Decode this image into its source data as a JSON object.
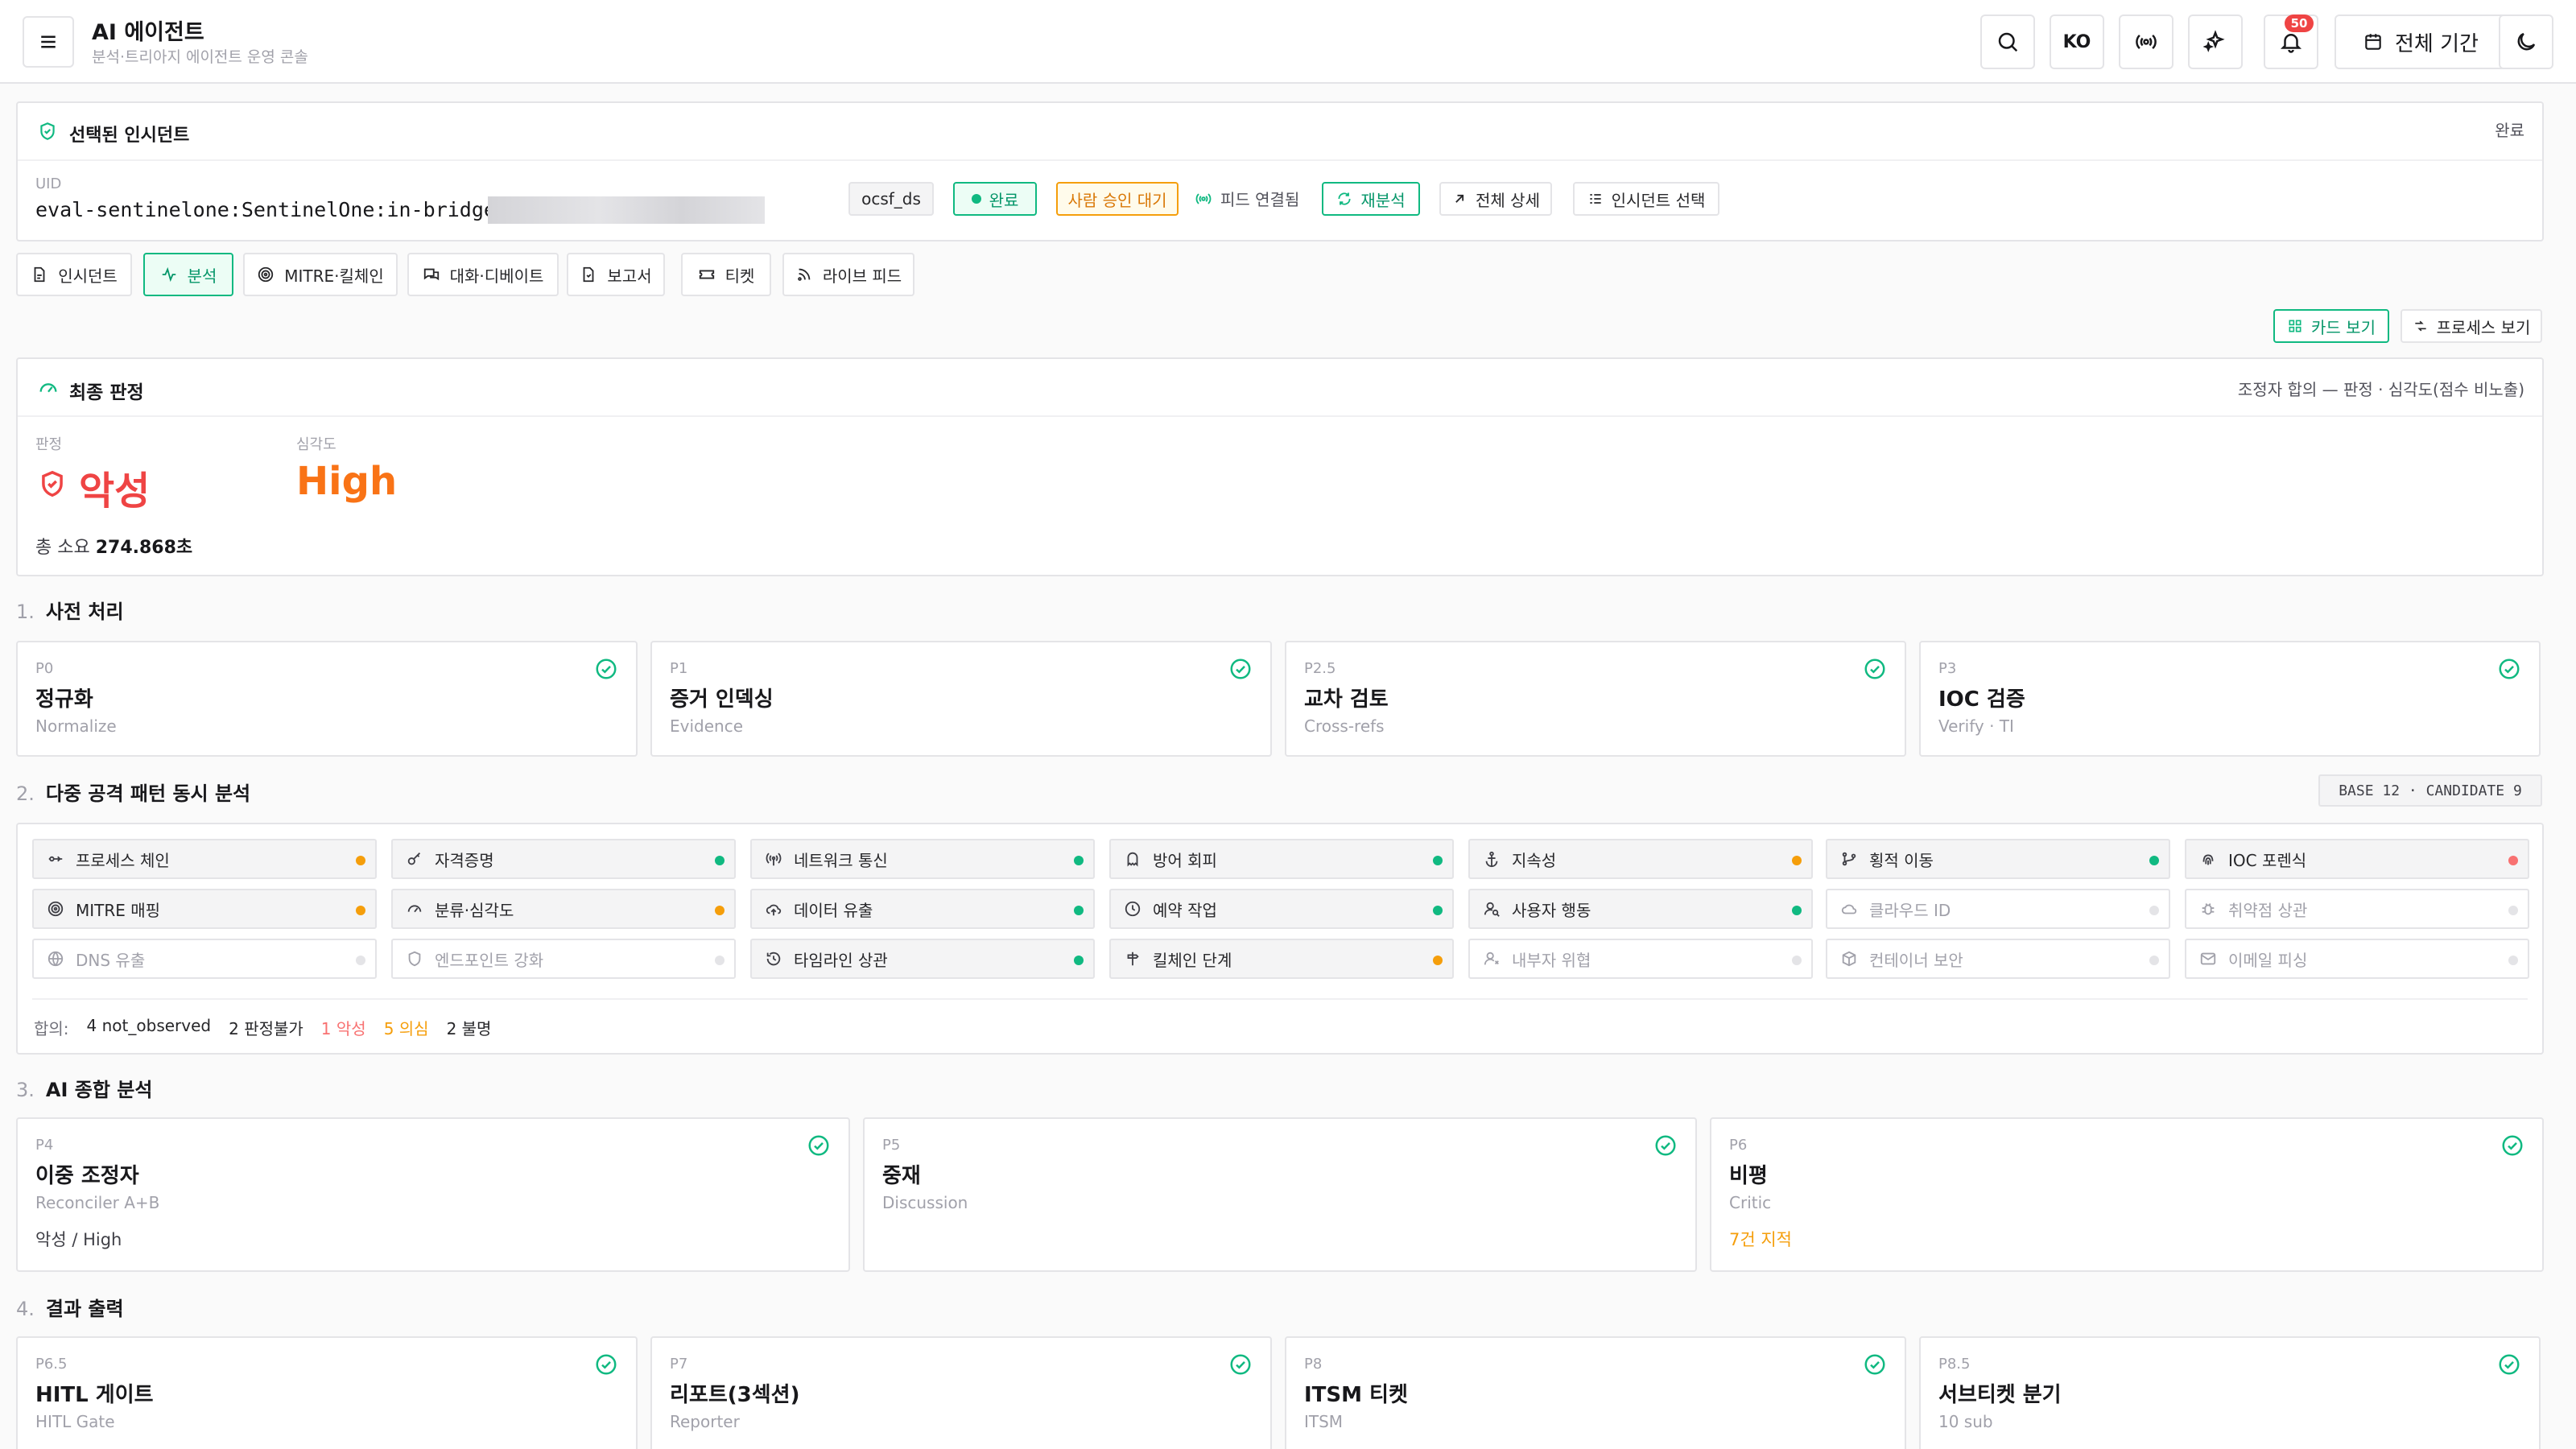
{
  "header": {
    "title": "AI 에이전트",
    "subtitle": "분석·트리아지 에이전트 운영 콘솔",
    "lang": "KO",
    "notif_count": "50",
    "period": "전체 기간"
  },
  "incident": {
    "title": "선택된 인시던트",
    "state_right": "완료",
    "uid_label": "UID",
    "uid_value": "eval-sentinelone:SentinelOne:in-bridge:",
    "tag_source": "ocsf_ds",
    "tag_status": "완료",
    "tag_approval": "사람 승인 대기",
    "feed_label": "피드 연결됨",
    "reanalyze": "재분석",
    "details": "전체 상세",
    "select": "인시던트 선택"
  },
  "tabs": [
    "인시던트",
    "분석",
    "MITRE·킬체인",
    "대화·디베이트",
    "보고서",
    "티켓",
    "라이브 피드"
  ],
  "view": {
    "card": "카드 보기",
    "process": "프로세스 보기"
  },
  "verdict": {
    "title": "최종 판정",
    "note": "조정자 합의 — 판정 · 심각도(점수 비노출)",
    "verdict_label": "판정",
    "verdict_value": "악성",
    "severity_label": "심각도",
    "severity_value": "High",
    "elapsed_label": "총 소요",
    "elapsed_value": "274.868초"
  },
  "sections": {
    "s1": {
      "num": "1.",
      "title": "사전 처리"
    },
    "s2": {
      "num": "2.",
      "title": "다중 공격 패턴 동시 분석",
      "badge": "BASE 12 · CANDIDATE 9"
    },
    "s3": {
      "num": "3.",
      "title": "AI 종합 분석"
    },
    "s4": {
      "num": "4.",
      "title": "결과 출력"
    }
  },
  "preprocess": [
    {
      "code": "P0",
      "name": "정규화",
      "sub": "Normalize"
    },
    {
      "code": "P1",
      "name": "증거 인덱싱",
      "sub": "Evidence"
    },
    {
      "code": "P2.5",
      "name": "교차 검토",
      "sub": "Cross-refs"
    },
    {
      "code": "P3",
      "name": "IOC 검증",
      "sub": "Verify · TI"
    }
  ],
  "patterns": [
    {
      "label": "프로세스 체인",
      "icon": "process-chain-icon",
      "status": "suspicious"
    },
    {
      "label": "자격증명",
      "icon": "key-icon",
      "status": "ok"
    },
    {
      "label": "네트워크 통신",
      "icon": "antenna-icon",
      "status": "ok"
    },
    {
      "label": "방어 회피",
      "icon": "ghost-icon",
      "status": "ok"
    },
    {
      "label": "지속성",
      "icon": "anchor-icon",
      "status": "suspicious"
    },
    {
      "label": "횡적 이동",
      "icon": "git-branch-icon",
      "status": "ok"
    },
    {
      "label": "IOC 포렌식",
      "icon": "fingerprint-icon",
      "status": "malicious"
    },
    {
      "label": "MITRE 매핑",
      "icon": "target-icon",
      "status": "suspicious"
    },
    {
      "label": "분류·심각도",
      "icon": "gauge-icon",
      "status": "suspicious"
    },
    {
      "label": "데이터 유출",
      "icon": "cloud-upload-icon",
      "status": "ok"
    },
    {
      "label": "예약 작업",
      "icon": "clock-icon",
      "status": "ok"
    },
    {
      "label": "사용자 행동",
      "icon": "user-search-icon",
      "status": "ok"
    },
    {
      "label": "클라우드 ID",
      "icon": "cloud-icon",
      "status": "inactive"
    },
    {
      "label": "취약점 상관",
      "icon": "bug-icon",
      "status": "inactive"
    },
    {
      "label": "DNS 유출",
      "icon": "globe-icon",
      "status": "inactive"
    },
    {
      "label": "엔드포인트 강화",
      "icon": "shield-icon",
      "status": "inactive"
    },
    {
      "label": "타임라인 상관",
      "icon": "history-icon",
      "status": "ok"
    },
    {
      "label": "킬체인 단계",
      "icon": "signpost-icon",
      "status": "suspicious"
    },
    {
      "label": "내부자 위협",
      "icon": "user-x-icon",
      "status": "inactive"
    },
    {
      "label": "컨테이너 보안",
      "icon": "container-icon",
      "status": "inactive"
    },
    {
      "label": "이메일 피싱",
      "icon": "mail-icon",
      "status": "inactive"
    }
  ],
  "consensus": {
    "label": "합의:",
    "not_observed": "4 not_observed",
    "undecidable": "2 판정불가",
    "malicious": "1 악성",
    "suspicious": "5 의심",
    "unknown": "2 불명"
  },
  "ai_analysis": [
    {
      "code": "P4",
      "name": "이중 조정자",
      "sub": "Reconciler A+B",
      "detail": "악성 / High"
    },
    {
      "code": "P5",
      "name": "중재",
      "sub": "Discussion",
      "detail": ""
    },
    {
      "code": "P6",
      "name": "비평",
      "sub": "Critic",
      "detail": "7건 지적"
    }
  ],
  "output": [
    {
      "code": "P6.5",
      "name": "HITL 게이트",
      "sub": "HITL Gate"
    },
    {
      "code": "P7",
      "name": "리포트(3섹션)",
      "sub": "Reporter"
    },
    {
      "code": "P8",
      "name": "ITSM 티켓",
      "sub": "ITSM"
    },
    {
      "code": "P8.5",
      "name": "서브티켓 분기",
      "sub": "10 sub"
    }
  ],
  "colors": {
    "accent": "#10b981",
    "ok": "#10b981",
    "suspicious": "#f59e0b",
    "malicious": "#f87171",
    "inactive": "#e4e4e7",
    "danger": "#ef4444",
    "severity_high": "#f97316"
  }
}
